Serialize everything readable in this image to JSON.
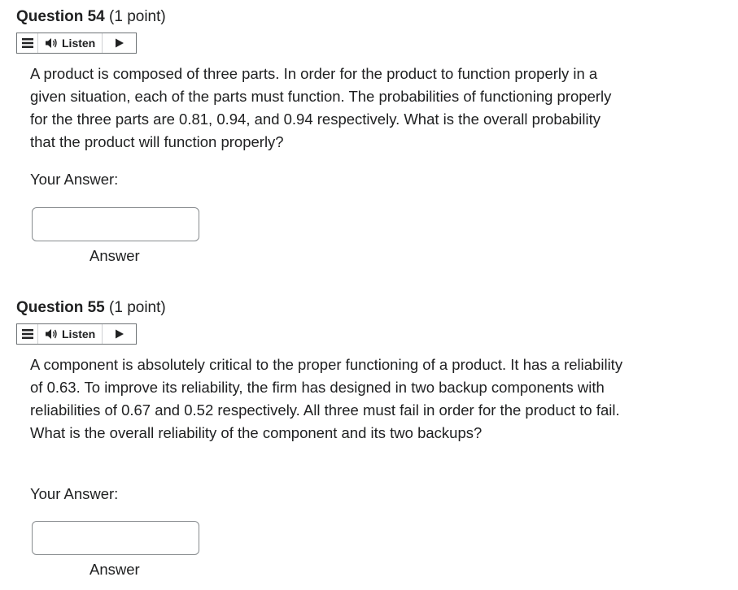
{
  "questions": [
    {
      "label": "Question 54",
      "points": "(1 point)",
      "listen_label": "Listen",
      "text": "A product is composed of three parts. In order for the product to function properly in a given situation, each of the parts must function. The probabilities of functioning properly for the three parts are 0.81, 0.94, and 0.94 respectively. What is the overall probability that the product will function properly?",
      "your_answer_label": "Your Answer:",
      "answer_value": "",
      "answer_caption": "Answer"
    },
    {
      "label": "Question 55",
      "points": "(1 point)",
      "listen_label": "Listen",
      "text": "A component is absolutely critical to the proper functioning of a product. It has a reliability of 0.63. To improve its reliability, the firm has designed in two backup components with reliabilities of 0.67 and 0.52 respectively. All three must fail in order for the product to fail. What is the overall reliability of the component and its two backups?",
      "your_answer_label": "Your Answer:",
      "answer_value": "",
      "answer_caption": "Answer"
    }
  ],
  "icons": {
    "menu": "menu-icon",
    "speaker": "speaker-icon",
    "play": "play-icon"
  },
  "colors": {
    "text": "#202122",
    "border": "#6e7376"
  }
}
